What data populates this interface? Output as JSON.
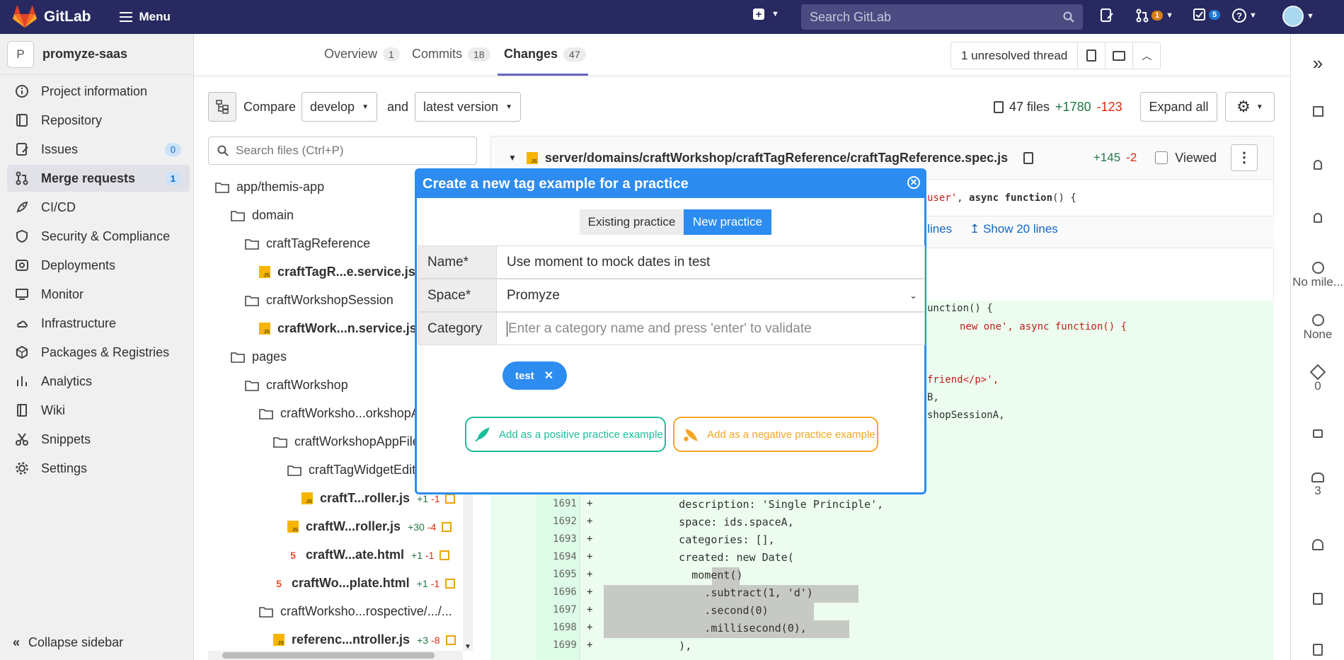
{
  "topbar": {
    "brand": "GitLab",
    "menu_label": "Menu",
    "search_placeholder": "Search GitLab",
    "mr_count": "1",
    "todo_count": "5"
  },
  "sidebar": {
    "project_initial": "P",
    "project_name": "promyze-saas",
    "items": [
      {
        "label": "Project information",
        "icon": "info-icon"
      },
      {
        "label": "Repository",
        "icon": "book-icon"
      },
      {
        "label": "Issues",
        "icon": "issues-icon",
        "count": "0"
      },
      {
        "label": "Merge requests",
        "icon": "merge-request-icon",
        "count": "1"
      },
      {
        "label": "CI/CD",
        "icon": "rocket-icon"
      },
      {
        "label": "Security & Compliance",
        "icon": "shield-icon"
      },
      {
        "label": "Deployments",
        "icon": "deployments-icon"
      },
      {
        "label": "Monitor",
        "icon": "monitor-icon"
      },
      {
        "label": "Infrastructure",
        "icon": "cloud-icon"
      },
      {
        "label": "Packages & Registries",
        "icon": "package-icon"
      },
      {
        "label": "Analytics",
        "icon": "chart-icon"
      },
      {
        "label": "Wiki",
        "icon": "wiki-icon"
      },
      {
        "label": "Snippets",
        "icon": "snippet-icon"
      },
      {
        "label": "Settings",
        "icon": "gear-icon"
      }
    ],
    "collapse_label": "Collapse sidebar"
  },
  "tabs": {
    "overview": "Overview",
    "overview_count": "1",
    "commits": "Commits",
    "commits_count": "18",
    "changes": "Changes",
    "changes_count": "47"
  },
  "thread": {
    "label": "1 unresolved thread"
  },
  "compare": {
    "label": "Compare",
    "from": "develop",
    "and": "and",
    "to": "latest version",
    "files": "47 files",
    "additions": "+1780",
    "deletions": "-123",
    "expand_all": "Expand all"
  },
  "filetree": {
    "search_placeholder": "Search files (Ctrl+P)",
    "items": [
      {
        "name": "app/themis-app",
        "type": "folder"
      },
      {
        "name": "domain",
        "type": "folder"
      },
      {
        "name": "craftTagReference",
        "type": "folder"
      },
      {
        "name": "craftTagR...e.service.js",
        "type": "js",
        "stat_add": "+"
      },
      {
        "name": "craftWorkshopSession",
        "type": "folder"
      },
      {
        "name": "craftWork...n.service.js",
        "type": "js",
        "stat_add": "+"
      },
      {
        "name": "pages",
        "type": "folder"
      },
      {
        "name": "craftWorkshop",
        "type": "folder"
      },
      {
        "name": "craftWorksho...orkshopAp",
        "type": "folder"
      },
      {
        "name": "craftWorkshopAppFile",
        "type": "folder"
      },
      {
        "name": "craftTagWidgetEdito",
        "type": "folder"
      },
      {
        "name": "craftT...roller.js",
        "type": "js",
        "stat_add": "+1",
        "stat_del": "-1"
      },
      {
        "name": "craftW...roller.js",
        "type": "js",
        "stat_add": "+30",
        "stat_del": "-4"
      },
      {
        "name": "craftW...ate.html",
        "type": "html",
        "stat_add": "+1",
        "stat_del": "-1"
      },
      {
        "name": "craftWo...plate.html",
        "type": "html",
        "stat_add": "+1",
        "stat_del": "-1"
      },
      {
        "name": "craftWorksho...rospective/.../...",
        "type": "folder"
      },
      {
        "name": "referenc...ntroller.js",
        "type": "js",
        "stat_add": "+3",
        "stat_del": "-8"
      }
    ]
  },
  "diff": {
    "file_path": "server/domains/craftWorkshop/craftTagReference/craftTagReference.spec.js",
    "additions": "+145",
    "deletions": "-2",
    "viewed_label": "Viewed",
    "context_line": "user', async function() {",
    "expand_lines": "d lines",
    "show_lines": "Show 20 lines",
    "visible_fragments": [
      "unction() {",
      "new one', async function() {",
      "friend</p>',",
      "B,",
      "shopSessionA,"
    ],
    "lines": [
      {
        "num": "1691",
        "code": "      description: 'Single Principle',"
      },
      {
        "num": "1692",
        "code": "      space: ids.spaceA,"
      },
      {
        "num": "1693",
        "code": "      categories: [],"
      },
      {
        "num": "1694",
        "code": "      created: new Date("
      },
      {
        "num": "1695",
        "code": "        moment()"
      },
      {
        "num": "1696",
        "code": "          .subtract(1, 'd')"
      },
      {
        "num": "1697",
        "code": "          .second(0)"
      },
      {
        "num": "1698",
        "code": "          .millisecond(0),"
      },
      {
        "num": "1699",
        "code": "      ),"
      }
    ]
  },
  "rightbar": {
    "milestone": "No mile...",
    "time": "None",
    "labels": "0",
    "participants": "3"
  },
  "modal": {
    "title": "Create a new tag example for a practice",
    "tab_existing": "Existing practice",
    "tab_new": "New practice",
    "name_label": "Name*",
    "name_value": "Use moment to mock dates in test",
    "space_label": "Space*",
    "space_value": "Promyze",
    "category_label": "Category",
    "category_placeholder": "Enter a category name and press 'enter' to validate",
    "chip": "test",
    "positive_label": "Add as a positive practice example",
    "negative_label": "Add as a negative practice example",
    "colors": {
      "primary": "#2d8cf0",
      "positive": "#19be9b",
      "negative": "#f5a623"
    }
  }
}
